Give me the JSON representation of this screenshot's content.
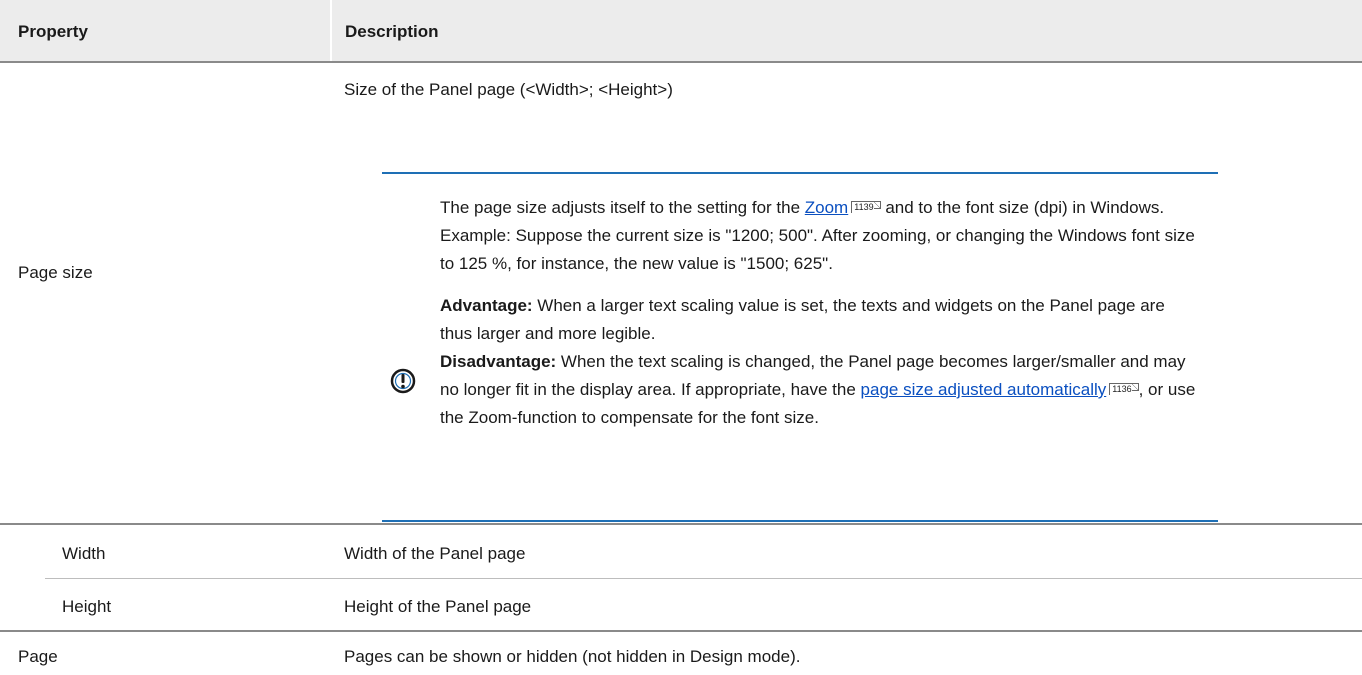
{
  "table": {
    "headers": {
      "property": "Property",
      "description": "Description"
    },
    "rows": {
      "page_size": {
        "property": "Page size",
        "description": "Size of the Panel page (<Width>; <Height>)",
        "note": {
          "line1_pre": "The page size adjusts itself to the setting for the ",
          "zoom_link": "Zoom",
          "zoom_ref": "1139",
          "line1_post": " and to the font size (dpi) in Windows.",
          "example": "Example: Suppose the current size is \"1200; 500\". After zooming, or changing the Windows font size to 125 %, for instance, the new value is \"1500; 625\".",
          "advantage_label": "Advantage:",
          "advantage_text": " When a larger text scaling value is set, the texts and widgets on the Panel page are thus larger and more legible.",
          "disadvantage_label": "Disadvantage:",
          "disadvantage_text": " When the text scaling is changed, the Panel page becomes larger/smaller and may no longer fit in the display area. If appropriate, have the ",
          "auto_link": "page size adjusted automatically",
          "auto_ref": "1136",
          "disadvantage_post": ", or use the Zoom-function to compensate for the font size.",
          "icon": "exclamation-circle-icon"
        }
      },
      "width": {
        "property": "Width",
        "description": "Width of the Panel page"
      },
      "height": {
        "property": "Height",
        "description": "Height of the Panel page"
      },
      "page": {
        "property": "Page",
        "description": "Pages can be shown or hidden (not hidden in Design mode)."
      }
    }
  },
  "colors": {
    "accent": "#1e6fb5",
    "link": "#0a4fc0",
    "header_bg": "#ececec"
  }
}
